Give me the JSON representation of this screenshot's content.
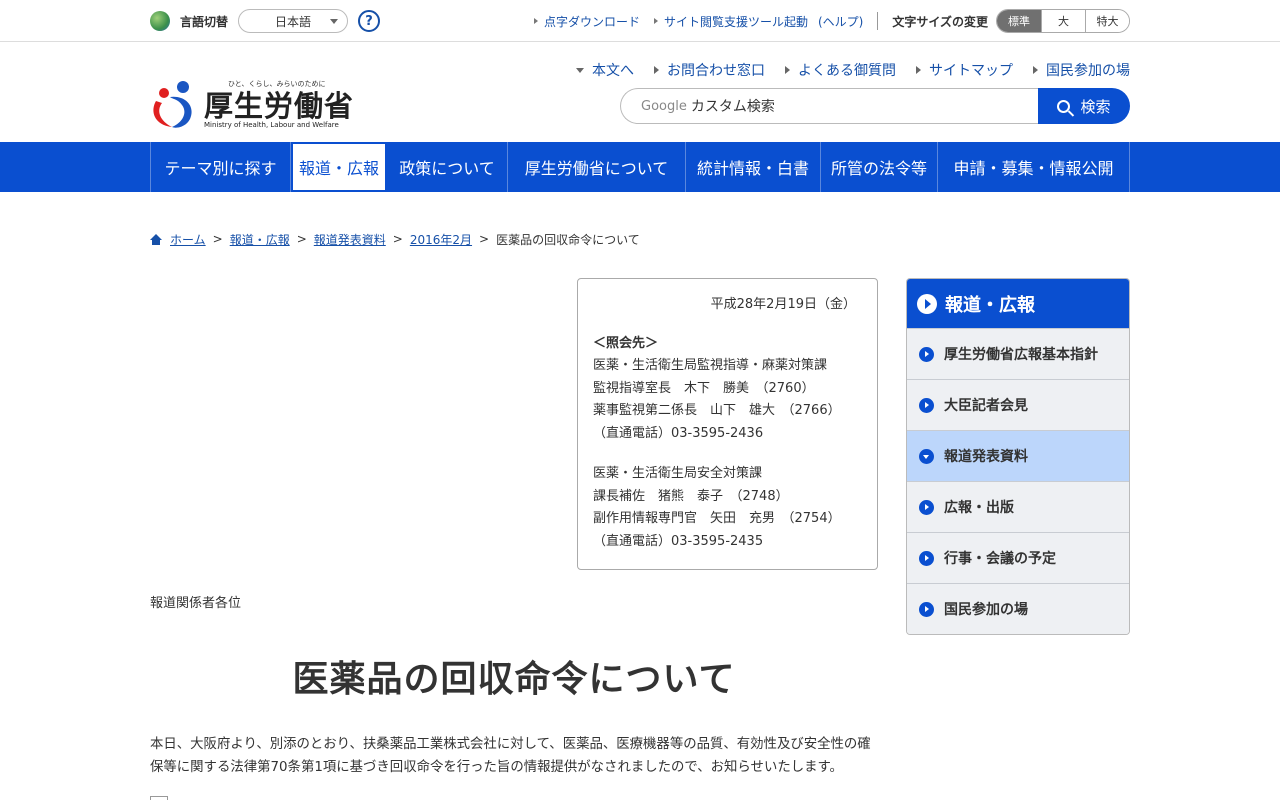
{
  "utility": {
    "lang_label": "言語切替",
    "lang_value": "日本語",
    "help_label": "?",
    "links": [
      "点字ダウンロード",
      "サイト閲覧支援ツール起動",
      "(ヘルプ)"
    ],
    "fontsize_label": "文字サイズの変更",
    "fontsize_options": [
      "標準",
      "大",
      "特大"
    ],
    "fontsize_selected": "標準"
  },
  "header": {
    "tagline": "ひと、くらし、みらいのために",
    "org_name": "厚生労働省",
    "org_name_en": "Ministry of Health, Labour and Welfare",
    "links": [
      "本文へ",
      "お問合わせ窓口",
      "よくある御質問",
      "サイトマップ",
      "国民参加の場"
    ],
    "search_brand": "Google",
    "search_placeholder": "カスタム検索",
    "search_button": "検索"
  },
  "nav": {
    "items": [
      "テーマ別に探す",
      "報道・広報",
      "政策について",
      "厚生労働省について",
      "統計情報・白書",
      "所管の法令等",
      "申請・募集・情報公開"
    ],
    "active": "報道・広報"
  },
  "breadcrumb": {
    "home": "ホーム",
    "items": [
      "報道・広報",
      "報道発表資料",
      "2016年2月"
    ],
    "current": "医薬品の回収命令について"
  },
  "contact": {
    "date": "平成28年2月19日（金）",
    "heading": "＜照会先＞",
    "block1": [
      "医薬・生活衛生局監視指導・麻薬対策課",
      "監視指導室長　木下　勝美　（2760）",
      "薬事監視第二係長　山下　雄大　（2766）",
      "（直通電話）03-3595-2436"
    ],
    "block2": [
      "医薬・生活衛生局安全対策課",
      "課長補佐　猪熊　泰子　（2748）",
      "副作用情報専門官　矢田　充男　（2754）",
      "（直通電話）03-3595-2435"
    ]
  },
  "article": {
    "addressee": "報道関係者各位",
    "title": "医薬品の回収命令について",
    "body": "本日、大阪府より、別添のとおり、扶桑薬品工業株式会社に対して、医薬品、医療機器等の品質、有効性及び安全性の確保等に関する法律第70条第1項に基づき回収命令を行った旨の情報提供がなされましたので、お知らせいたします。"
  },
  "sidenav": {
    "heading": "報道・広報",
    "items": [
      "厚生労働省広報基本指針",
      "大臣記者会見",
      "報道発表資料",
      "広報・出版",
      "行事・会議の予定",
      "国民参加の場"
    ],
    "active": "報道発表資料"
  },
  "colors": {
    "brand_blue": "#0a4fd0",
    "link_blue": "#1650a8",
    "sidenav_active": "#bcd6fb"
  },
  "icons": [
    "globe-icon",
    "help-icon",
    "search-icon",
    "home-icon",
    "circle-arrow-icon",
    "attachment-icon"
  ]
}
